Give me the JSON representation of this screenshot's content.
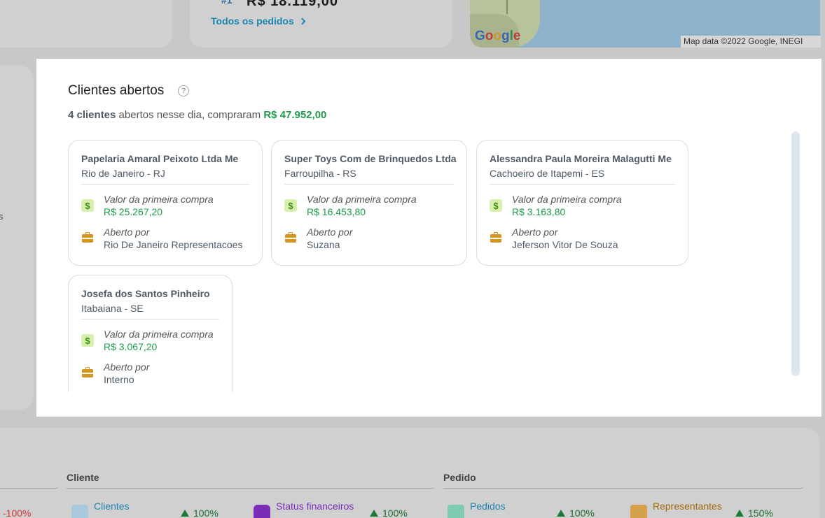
{
  "background": {
    "rank": "#1",
    "price": "R$ 18.119,00",
    "orders_link": "Todos os pedidos",
    "map_logo": "Google",
    "map_attribution": "Map data ©2022 Google, INEGI",
    "side_letter": "s",
    "negative_change": "-100%",
    "sections": [
      {
        "title": "Cliente"
      },
      {
        "title": "Pedido"
      }
    ],
    "stats": [
      {
        "label": "Clientes",
        "change": "100%",
        "color": "#1d86b0"
      },
      {
        "label": "Status financeiros",
        "change": "100%",
        "color": "#7b2db8"
      },
      {
        "label": "Pedidos",
        "change": "100%",
        "color": "#1d86b0"
      },
      {
        "label": "Representantes",
        "change": "150%",
        "color": "#a66b0e"
      }
    ]
  },
  "modal": {
    "title": "Clientes abertos",
    "help_icon": "?",
    "subtitle": {
      "count": "4 clientes",
      "middle": "abertos nesse dia, compraram",
      "amount": "R$ 47.952,00"
    },
    "first_purchase_label": "Valor da primeira compra",
    "opened_by_label": "Aberto por",
    "money_icon_glyph": "$",
    "clients": [
      {
        "name": "Papelaria Amaral Peixoto Ltda Me",
        "city": "Rio de Janeiro - RJ",
        "first_purchase": "R$ 25.267,20",
        "opened_by": "Rio De Janeiro Representacoes"
      },
      {
        "name": "Super Toys Com de Brinquedos Ltda",
        "city": "Farroupilha - RS",
        "first_purchase": "R$ 16.453,80",
        "opened_by": "Suzana"
      },
      {
        "name": "Alessandra Paula Moreira Malagutti Me",
        "city": "Cachoeiro de Itapemi - ES",
        "first_purchase": "R$ 3.163,80",
        "opened_by": "Jeferson Vitor De Souza"
      },
      {
        "name": "Josefa dos Santos Pinheiro",
        "city": "Itabaiana - SE",
        "first_purchase": "R$ 3.067,20",
        "opened_by": "Interno"
      }
    ]
  }
}
